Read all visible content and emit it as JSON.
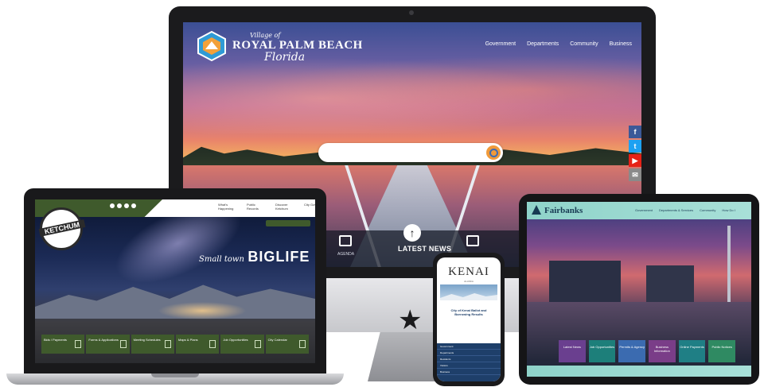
{
  "desktop": {
    "site": {
      "title_pre": "Village of",
      "title_main": "ROYAL PALM BEACH",
      "title_script": "Florida"
    },
    "nav": [
      "Government",
      "Departments",
      "Community",
      "Business"
    ],
    "social_icons": [
      "facebook-icon",
      "twitter-icon",
      "youtube-icon",
      "email-icon"
    ],
    "feature": {
      "label": "LATEST NEWS",
      "sub_left": "AGENDA"
    }
  },
  "laptop": {
    "logo": "KETCHUM",
    "nav": [
      "What's Happening",
      "Public Records",
      "Discover Ketchum",
      "City Gov't"
    ],
    "tagline_small": "Small town",
    "tagline_big": "BIGLIFE",
    "tiles": [
      "Bids / Payments",
      "Forms & Applications",
      "Meeting Schedules",
      "Maps & Plans",
      "Job Opportunities",
      "City Calendar"
    ]
  },
  "tablet": {
    "title": "Fairbanks",
    "nav": [
      "Government",
      "Departments & Services",
      "Community",
      "How Do I"
    ],
    "tiles": [
      {
        "label": "Latest News",
        "color": "#6a3f8f"
      },
      {
        "label": "Job Opportunities",
        "color": "#1d7f7a"
      },
      {
        "label": "Permits & Agency",
        "color": "#3b6bb0"
      },
      {
        "label": "Business Information",
        "color": "#7a3d88"
      },
      {
        "label": "Online Payments",
        "color": "#1f7f85"
      },
      {
        "label": "Public Notices",
        "color": "#2f8a62"
      }
    ]
  },
  "phone": {
    "title": "KENAI",
    "subtitle": "ALASKA",
    "notice": "City of Kenai Ballot and Borrowing Results",
    "menu": [
      "Government",
      "Departments",
      "Residents",
      "Visitors",
      "Business"
    ]
  },
  "colors": {
    "ketchum_green": "#3f5a2c",
    "fairbanks_teal": "#8fd3c9",
    "kenai_navy": "#1e3f6a",
    "rpb_search_button": "#f09a3a"
  }
}
